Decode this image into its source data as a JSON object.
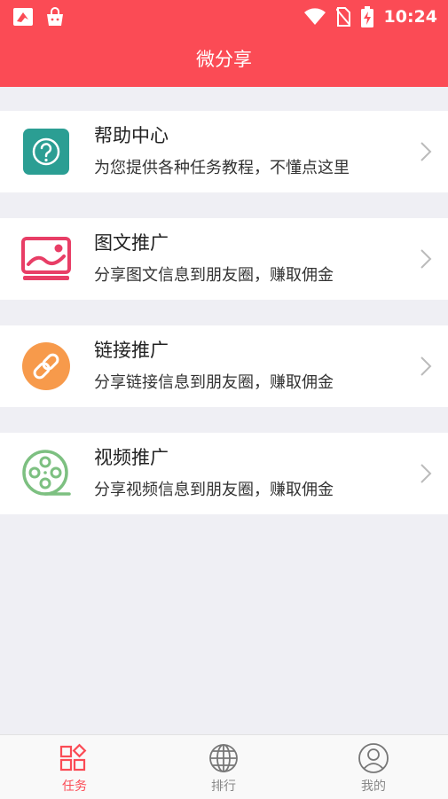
{
  "status_bar": {
    "time": "10:24"
  },
  "header": {
    "title": "微分享"
  },
  "cards": [
    {
      "title": "帮助中心",
      "subtitle": "为您提供各种任务教程，不懂点这里",
      "icon": "help-icon",
      "color": "#2b9e93"
    },
    {
      "title": "图文推广",
      "subtitle": "分享图文信息到朋友圈，赚取佣金",
      "icon": "image-icon",
      "color": "#e83e66"
    },
    {
      "title": "链接推广",
      "subtitle": "分享链接信息到朋友圈，赚取佣金",
      "icon": "link-icon",
      "color": "#f79a4b"
    },
    {
      "title": "视频推广",
      "subtitle": "分享视频信息到朋友圈，赚取佣金",
      "icon": "film-reel-icon",
      "color": "#7dc081"
    }
  ],
  "tabbar": {
    "active_index": 0,
    "tabs": [
      {
        "label": "任务",
        "icon": "tasks-grid-icon"
      },
      {
        "label": "排行",
        "icon": "globe-icon"
      },
      {
        "label": "我的",
        "icon": "user-icon"
      }
    ]
  },
  "colors": {
    "accent": "#fb4b55",
    "background": "#efeff4"
  }
}
